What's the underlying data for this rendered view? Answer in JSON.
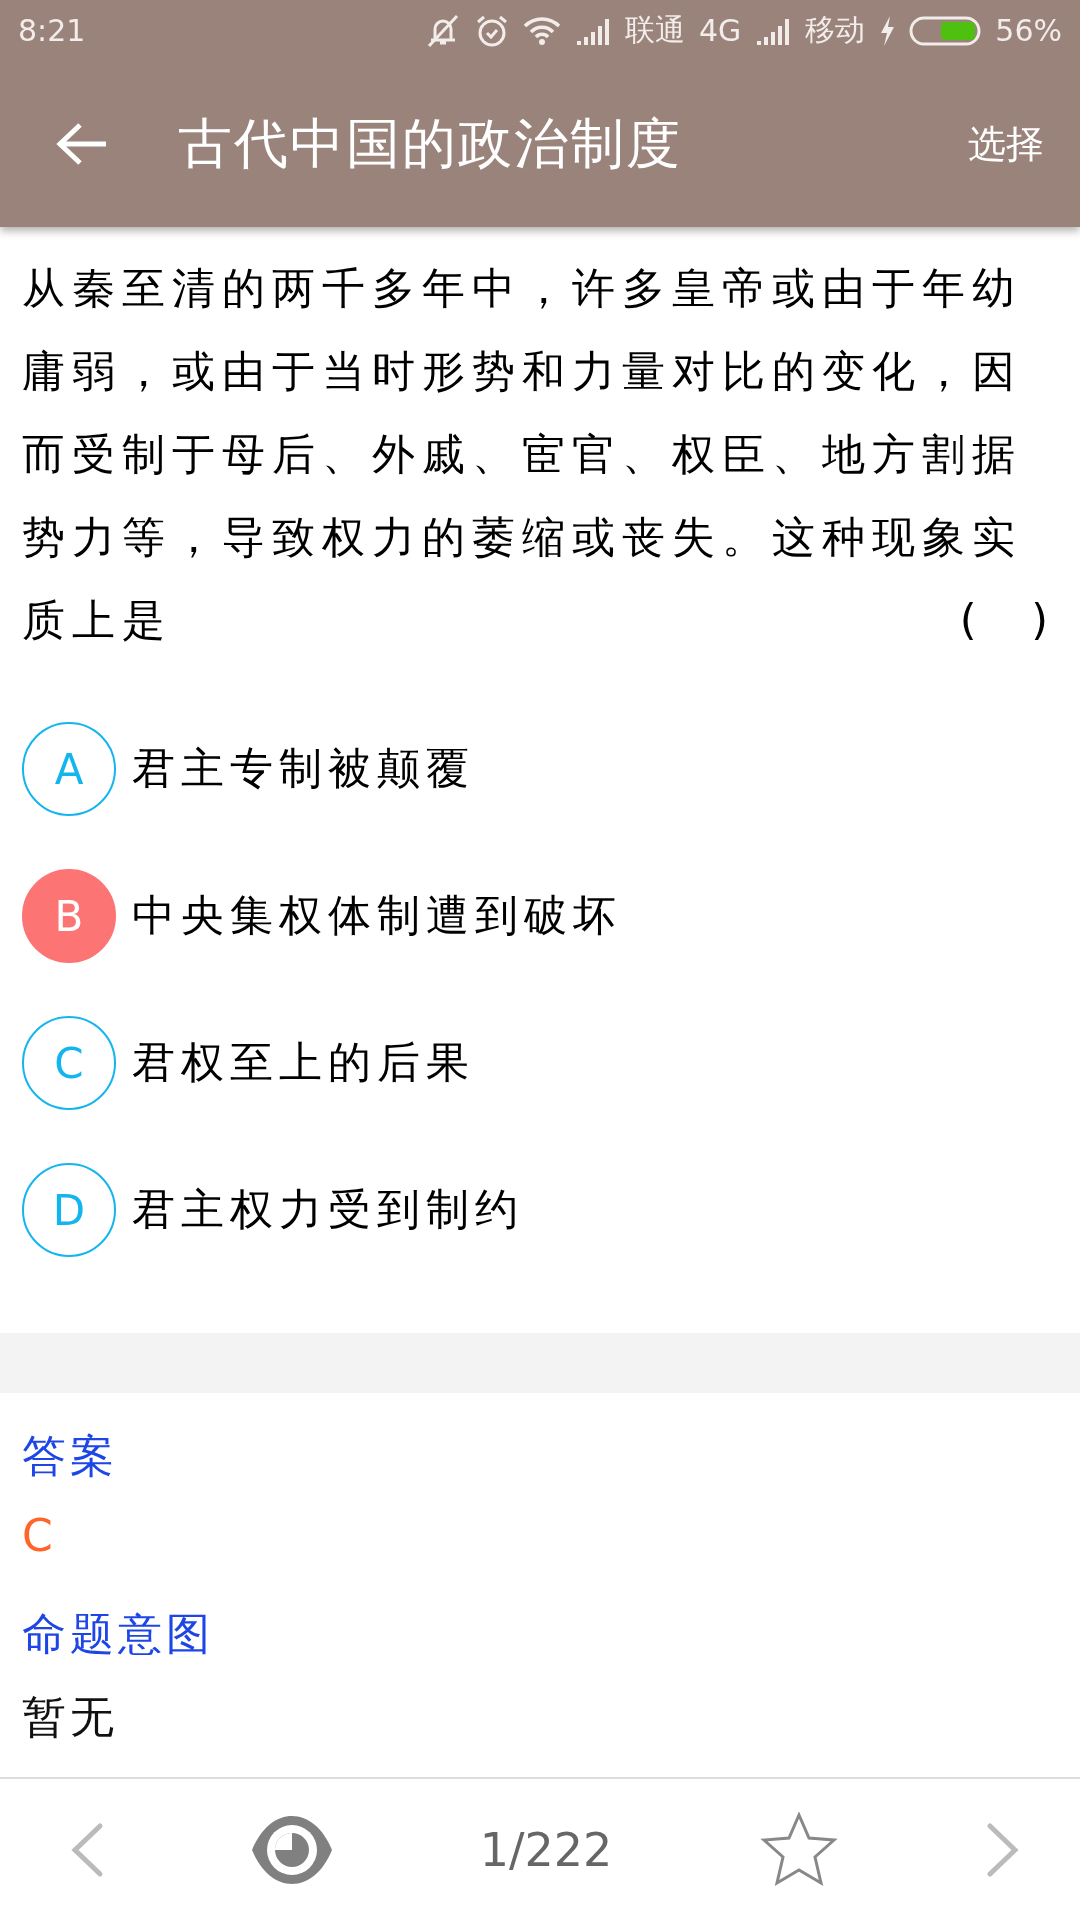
{
  "status_bar": {
    "time": "8:21",
    "carrier_1": "联通",
    "network": "4G",
    "carrier_2": "移动",
    "battery": "56%"
  },
  "app_bar": {
    "title": "古代中国的政治制度",
    "action": "选择"
  },
  "question": {
    "text": "从秦至清的两千多年中，许多皇帝或由于年幼庸弱，或由于当时形势和力量对比的变化，因而受制于母后、外戚、宦官、权臣、地方割据势力等，导致权力的萎缩或丧失。这种现象实质上是",
    "blank": "(    )"
  },
  "options": [
    {
      "letter": "A",
      "text": "君主专制被颠覆",
      "selected": false
    },
    {
      "letter": "B",
      "text": "中央集权体制遭到破坏",
      "selected": true
    },
    {
      "letter": "C",
      "text": "君权至上的后果",
      "selected": false
    },
    {
      "letter": "D",
      "text": "君主权力受到制约",
      "selected": false
    }
  ],
  "answer": {
    "label": "答案",
    "value": "C"
  },
  "intent": {
    "label": "命题意图",
    "value": "暂无"
  },
  "bottom_bar": {
    "page": "1/222"
  }
}
